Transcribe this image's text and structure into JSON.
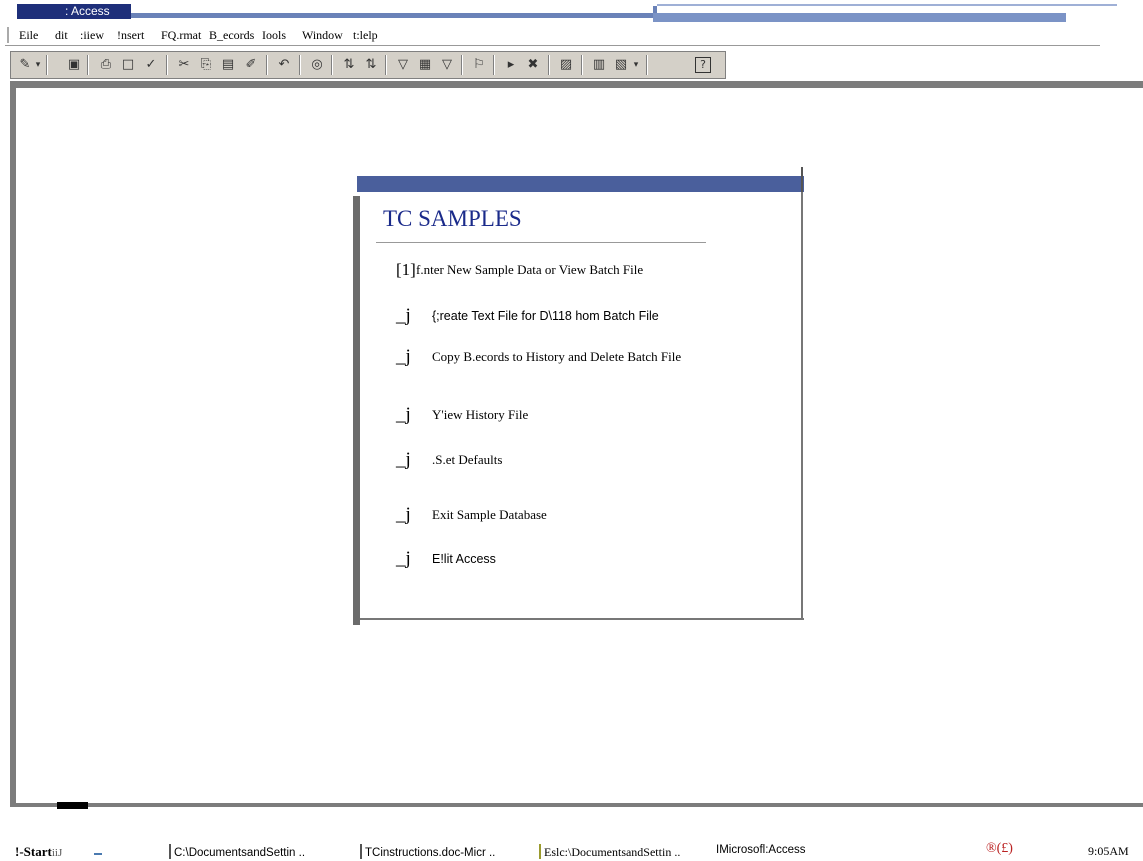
{
  "window": {
    "title": ": Access"
  },
  "menu": {
    "items": [
      "Eile",
      "dit",
      ":iiew",
      "!nsert",
      "FQ.rmat",
      "B_ecords",
      "Iools",
      "Window",
      "t:lelp"
    ]
  },
  "toolbar": {
    "icons": [
      "design-view-icon",
      "save-icon",
      "print-icon",
      "print-preview-icon",
      "spelling-icon",
      "cut-icon",
      "copy-icon",
      "paste-icon",
      "format-painter-icon",
      "undo-icon",
      "web-icon",
      "sort-ascending-icon",
      "sort-descending-icon",
      "filter-by-selection-icon",
      "filter-by-form-icon",
      "apply-filter-icon",
      "find-icon",
      "new-record-icon",
      "delete-record-icon",
      "properties-icon",
      "database-window-icon",
      "new-object-icon",
      "help-icon"
    ]
  },
  "switchboard": {
    "title": "TC SAMPLES",
    "items": [
      {
        "button": "[1]",
        "label": "f.nter New Sample Data or View Batch File"
      },
      {
        "button": "_j",
        "label": "{;reate Text File for D\\118 hom Batch File"
      },
      {
        "button": "_j",
        "label": "Copy B.ecords to History and Delete Batch File"
      },
      {
        "button": "_j",
        "label": "Y'iew History File"
      },
      {
        "button": "_j",
        "label": ".S.et Defaults"
      },
      {
        "button": "_j",
        "label": "Exit Sample Database"
      },
      {
        "button": "_j",
        "label": "E!lit Access"
      }
    ]
  },
  "taskbar": {
    "start_label": "!-Start",
    "start_suffix": "iiJ",
    "tasks": [
      "C:\\DocumentsandSettin ..",
      "TCinstructions.doc-Micr ..",
      "Eslc:\\DocumentsandSettin ..",
      "IMicrosofl:Access"
    ],
    "tray_icons": "®(£)",
    "clock": "9:05AM"
  }
}
